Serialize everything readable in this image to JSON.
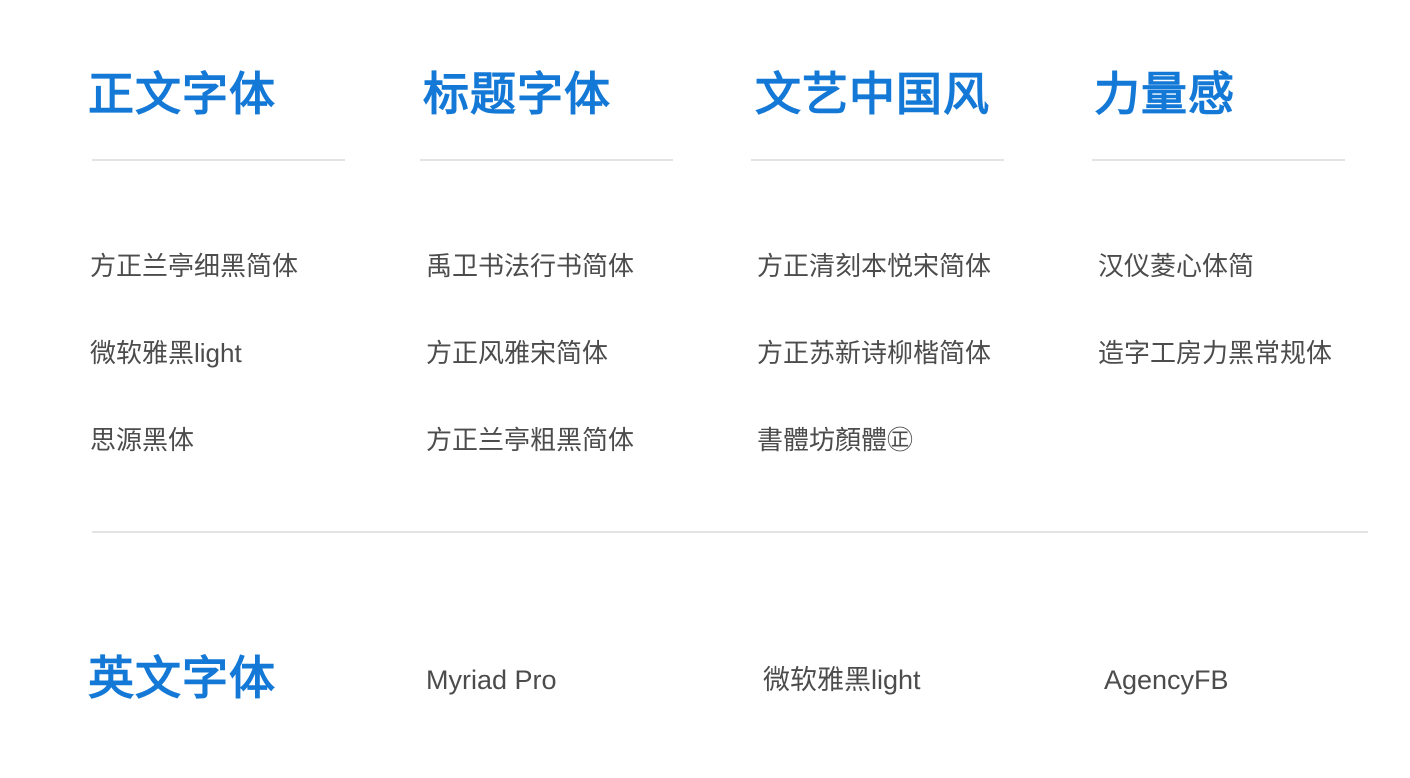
{
  "colors": {
    "heading": "#1479d6",
    "body_text": "#4c4c4c",
    "rule": "#e3e3e3"
  },
  "columns": [
    {
      "title": "正文字体",
      "fonts": [
        "方正兰亭细黑简体",
        "微软雅黑light",
        "思源黑体"
      ]
    },
    {
      "title": "标题字体",
      "fonts": [
        "禹卫书法行书简体",
        "方正风雅宋简体",
        "方正兰亭粗黑简体"
      ]
    },
    {
      "title": "文艺中国风",
      "fonts": [
        "方正清刻本悦宋简体",
        "方正苏新诗柳楷简体",
        "書體坊顏體㊣"
      ]
    },
    {
      "title": "力量感",
      "fonts": [
        "汉仪菱心体简",
        "造字工房力黑常规体"
      ]
    }
  ],
  "english": {
    "title": "英文字体",
    "fonts": [
      "Myriad Pro",
      "微软雅黑light",
      "AgencyFB"
    ]
  }
}
